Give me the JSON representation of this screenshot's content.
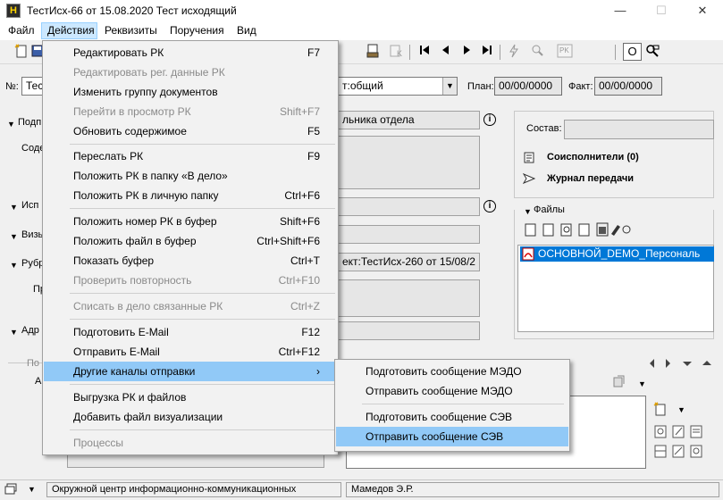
{
  "window": {
    "app_icon_letter": "Н",
    "title": "ТестИсх-66 от 15.08.2020 Тест исходящий",
    "minimize": "—",
    "maximize": "☐",
    "close": "✕"
  },
  "menubar": {
    "items": [
      "Файл",
      "Действия",
      "Реквизиты",
      "Поручения",
      "Вид"
    ]
  },
  "toolbar": {
    "zoom_glyph": "O"
  },
  "form": {
    "number_label": "№:",
    "number_value": "Тест",
    "access_value": "т:общий",
    "plan_label": "План:",
    "plan_value": "00/00/0000",
    "fact_label": "Факт:",
    "fact_value": "00/00/0000",
    "signer_label": "Подп",
    "signer_value": "льника отдела",
    "content_label": "Соде",
    "executor_label": "Исп",
    "visa_label": "Визы",
    "rubric_label": "Рубр",
    "rubric_value": "ект:ТестИсх-260 от 15/08/2",
    "pr_label": "Пр",
    "addr_label": "Адр",
    "po_label": "По",
    "a_label": "А",
    "composition_label": "Состав:",
    "coexecutors": "Соисполнители (0)",
    "transfer_log": "Журнал передачи",
    "files_label": "Файлы",
    "file_name": "ОСНОВНОЙ_DEMO_Персональ"
  },
  "actions_menu": [
    {
      "label": "Редактировать РК",
      "shortcut": "F7",
      "disabled": false
    },
    {
      "label": "Редактировать рег. данные РК",
      "shortcut": "",
      "disabled": true
    },
    {
      "label": "Изменить группу документов",
      "shortcut": "",
      "disabled": false
    },
    {
      "label": "Перейти в просмотр РК",
      "shortcut": "Shift+F7",
      "disabled": true
    },
    {
      "label": "Обновить содержимое",
      "shortcut": "F5",
      "disabled": false
    },
    {
      "label": "Переслать РК",
      "shortcut": "F9",
      "disabled": false
    },
    {
      "label": "Положить РК в папку «В дело»",
      "shortcut": "",
      "disabled": false
    },
    {
      "label": "Положить РК в личную папку",
      "shortcut": "Ctrl+F6",
      "disabled": false
    },
    {
      "label": "Положить номер РК в буфер",
      "shortcut": "Shift+F6",
      "disabled": false
    },
    {
      "label": "Положить файл в буфер",
      "shortcut": "Ctrl+Shift+F6",
      "disabled": false
    },
    {
      "label": "Показать буфер",
      "shortcut": "Ctrl+T",
      "disabled": false
    },
    {
      "label": "Проверить повторность",
      "shortcut": "Ctrl+F10",
      "disabled": true
    },
    {
      "label": "Списать в дело связанные РК",
      "shortcut": "Ctrl+Z",
      "disabled": true
    },
    {
      "label": "Подготовить E-Mail",
      "shortcut": "F12",
      "disabled": false
    },
    {
      "label": "Отправить E-Mail",
      "shortcut": "Ctrl+F12",
      "disabled": false
    },
    {
      "label": "Другие каналы отправки",
      "shortcut": "›",
      "disabled": false
    },
    {
      "label": "Выгрузка РК и файлов",
      "shortcut": "",
      "disabled": false
    },
    {
      "label": "Добавить файл визуализации",
      "shortcut": "",
      "disabled": false
    },
    {
      "label": "Процессы",
      "shortcut": "",
      "disabled": true
    }
  ],
  "send_submenu": [
    {
      "label": "Подготовить сообщение МЭДО"
    },
    {
      "label": "Отправить сообщение МЭДО"
    },
    {
      "label": "Подготовить сообщение СЭВ"
    },
    {
      "label": "Отправить сообщение СЭВ"
    }
  ],
  "statusbar": {
    "organization": "Окружной центр информационно-коммуникационных",
    "user": "Мамедов Э.Р."
  }
}
